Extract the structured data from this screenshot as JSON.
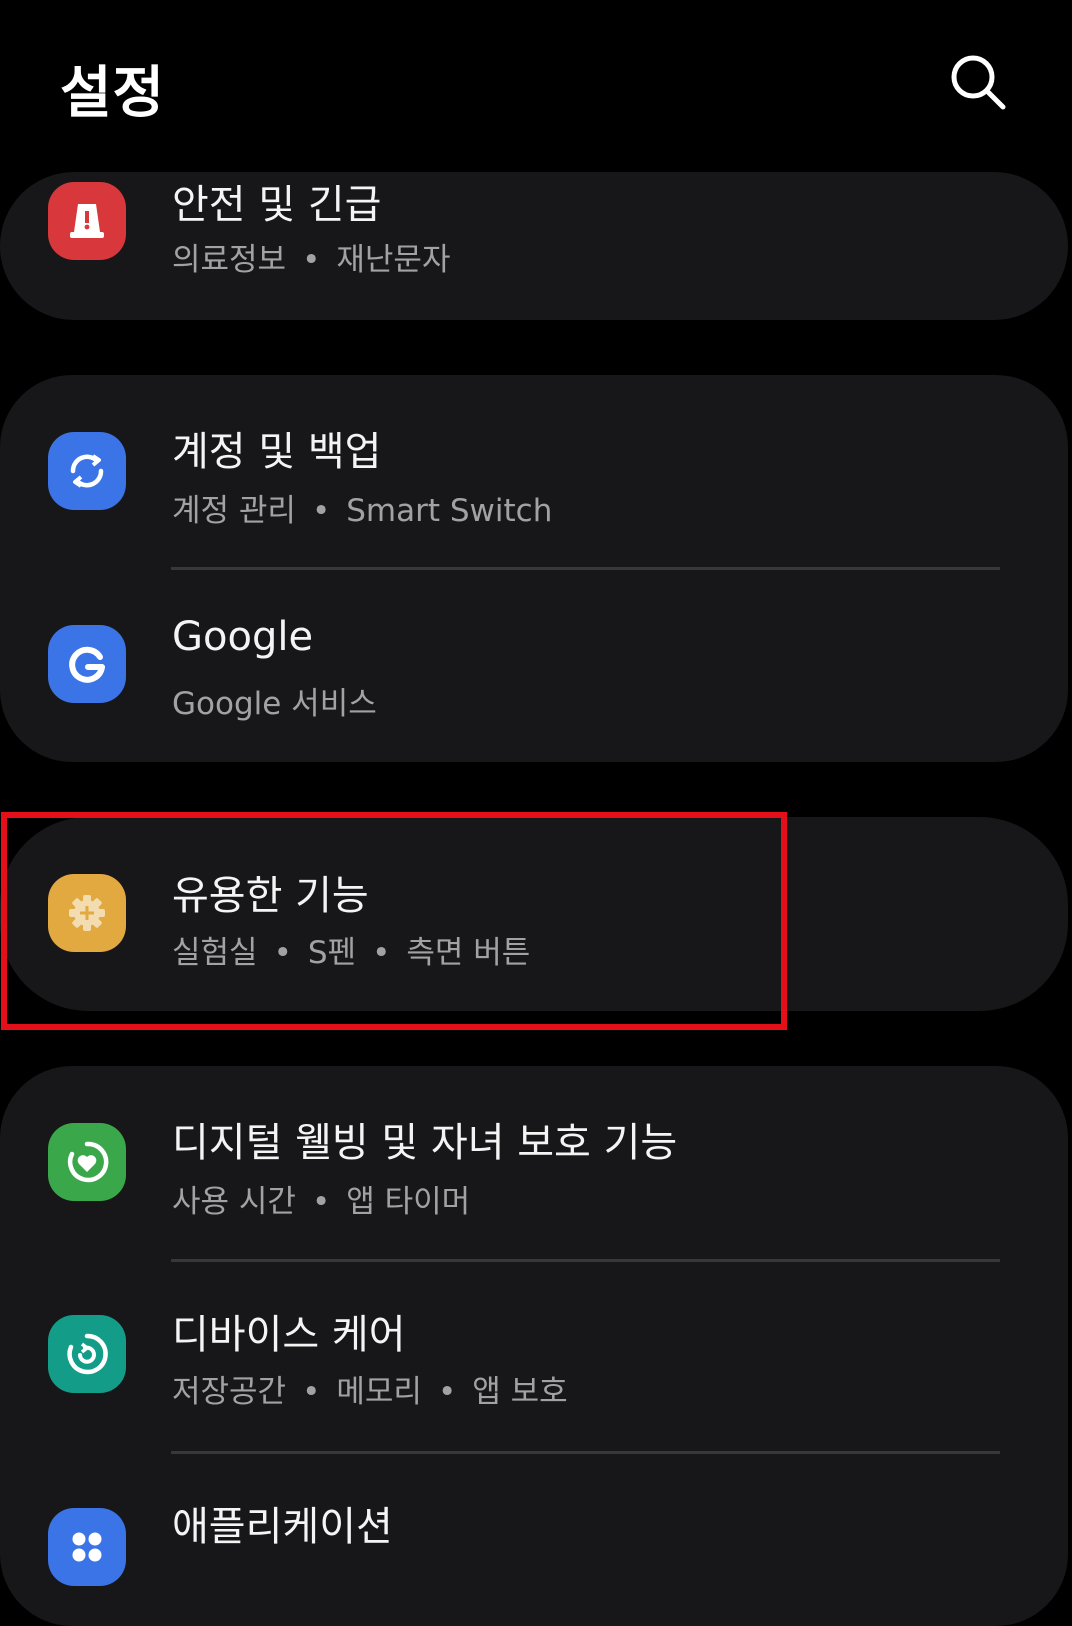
{
  "header": {
    "title": "설정",
    "search_icon": "search-icon"
  },
  "colors": {
    "background": "#000000",
    "card": "#171719",
    "highlight": "#e3101a",
    "safety_icon": "#d8373b",
    "accounts_icon": "#3a74e6",
    "google_icon": "#3a74e6",
    "advanced_icon": "#e2a940",
    "wellbeing_icon": "#3aa84a",
    "device_care_icon": "#139d89",
    "apps_icon": "#3a74e6"
  },
  "rows": {
    "safety": {
      "title": "안전 및 긴급",
      "sub": [
        "의료정보",
        "재난문자"
      ],
      "icon": "alert-icon"
    },
    "accounts": {
      "title": "계정 및 백업",
      "sub": [
        "계정 관리",
        "Smart Switch"
      ],
      "icon": "sync-icon"
    },
    "google": {
      "title": "Google",
      "sub": [
        "Google 서비스"
      ],
      "icon": "google-icon"
    },
    "advanced": {
      "title": "유용한 기능",
      "sub": [
        "실험실",
        "S펜",
        "측면 버튼"
      ],
      "icon": "gear-plus-icon"
    },
    "wellbeing": {
      "title": "디지털 웰빙 및 자녀 보호 기능",
      "sub": [
        "사용 시간",
        "앱 타이머"
      ],
      "icon": "heart-ring-icon"
    },
    "device_care": {
      "title": "디바이스 케어",
      "sub": [
        "저장공간",
        "메모리",
        "앱 보호"
      ],
      "icon": "refresh-ring-icon"
    },
    "apps": {
      "title": "애플리케이션",
      "icon": "apps-grid-icon"
    }
  }
}
